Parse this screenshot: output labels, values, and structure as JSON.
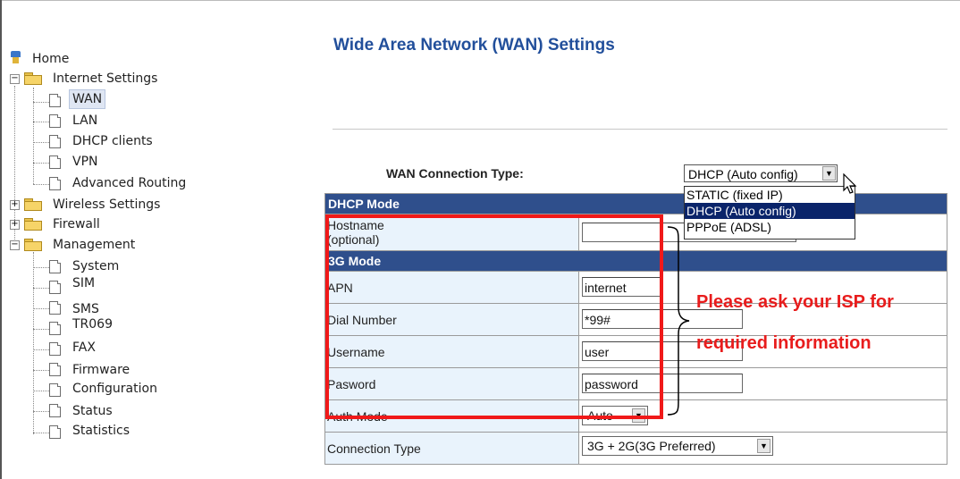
{
  "sidebar": {
    "home": "Home",
    "internet_settings": {
      "label": "Internet Settings",
      "items": [
        "WAN",
        "LAN",
        "DHCP clients",
        "VPN",
        "Advanced Routing"
      ]
    },
    "wireless_settings": "Wireless Settings",
    "firewall": "Firewall",
    "management": {
      "label": "Management",
      "items": [
        "System",
        "SIM",
        "SMS",
        "TR069",
        "FAX",
        "Firmware",
        "Configuration",
        "Status",
        "Statistics"
      ]
    },
    "selected": "WAN"
  },
  "main": {
    "title": "Wide Area Network (WAN) Settings",
    "connection_type_label": "WAN Connection Type:",
    "connection_type_value": "DHCP (Auto config)",
    "connection_type_options": [
      "STATIC (fixed IP)",
      "DHCP (Auto config)",
      "PPPoE (ADSL)"
    ],
    "dhcp_header": "DHCP Mode",
    "hostname_label_1": "Hostname",
    "hostname_label_2": "(optional)",
    "hostname_value": "",
    "g3_header": "3G Mode",
    "apn_label": "APN",
    "apn_value": "internet",
    "dial_label": "Dial Number",
    "dial_value": "*99#",
    "username_label": "Username",
    "username_value": "user",
    "password_label": "Pasword",
    "password_value": "password",
    "auth_label": "Auth Mode",
    "auth_value": "Auto",
    "ctype_label": "Connection Type",
    "ctype_value": "3G + 2G(3G Preferred)"
  },
  "annotation": {
    "line1": "Please ask your ISP for",
    "line2": "required information",
    "color": "#e81c1c"
  }
}
